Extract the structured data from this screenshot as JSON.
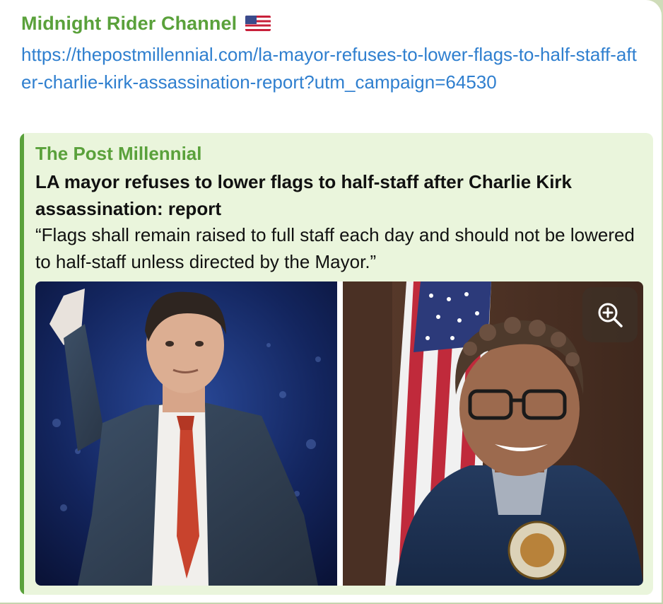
{
  "message": {
    "channel_name": "Midnight Rider Channel",
    "channel_emoji": "us-flag-icon",
    "link_text": "https://thepostmillennial.com/la-mayor-refuses-to-lower-flags-to-half-staff-after-charlie-kirk-assassination-report?utm_campaign=64530"
  },
  "preview": {
    "site_name": "The Post Millennial",
    "title": "LA mayor refuses to lower flags to half-staff after Charlie Kirk assassination: report",
    "description": "“Flags shall remain raised to full staff each day and should not be lowered to half-staff unless directed by the Mayor.”",
    "image": {
      "left_alt": "man-in-suit-waving-photo",
      "right_alt": "woman-with-glasses-and-flag-photo",
      "zoom_icon": "zoom-in-icon"
    }
  },
  "colors": {
    "accent_green": "#5aa13b",
    "link_blue": "#2f7fcf",
    "preview_bg": "#eaf5dc",
    "chat_bg": "#c9d8b4"
  }
}
